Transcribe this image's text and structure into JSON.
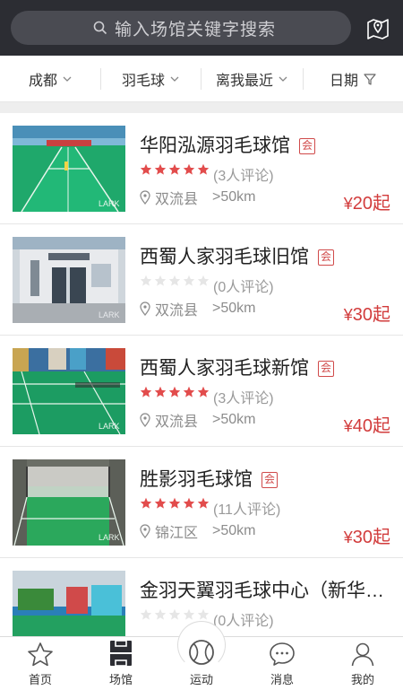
{
  "header": {
    "search_placeholder": "输入场馆关键字搜索",
    "icons": {
      "search": "search-icon",
      "map": "map-pin-icon"
    }
  },
  "filters": {
    "city": "成都",
    "sport": "羽毛球",
    "sort": "离我最近",
    "date": "日期"
  },
  "venues": [
    {
      "name": "华阳泓源羽毛球馆",
      "badge": "会",
      "stars": 5,
      "reviews": "(3人评论)",
      "district": "双流县",
      "distance": ">50km",
      "price": "20",
      "price_suffix": "起"
    },
    {
      "name": "西蜀人家羽毛球旧馆",
      "badge": "会",
      "stars": 0,
      "reviews": "(0人评论)",
      "district": "双流县",
      "distance": ">50km",
      "price": "30",
      "price_suffix": "起"
    },
    {
      "name": "西蜀人家羽毛球新馆",
      "badge": "会",
      "stars": 5,
      "reviews": "(3人评论)",
      "district": "双流县",
      "distance": ">50km",
      "price": "40",
      "price_suffix": "起"
    },
    {
      "name": "胜影羽毛球馆",
      "badge": "会",
      "stars": 5,
      "reviews": "(11人评论)",
      "district": "锦江区",
      "distance": ">50km",
      "price": "30",
      "price_suffix": "起"
    },
    {
      "name": "金羽天翼羽毛球中心（新华…",
      "badge": "",
      "stars": 0,
      "reviews": "(0人评论)",
      "district": "",
      "distance": "",
      "price": "",
      "price_suffix": ""
    }
  ],
  "currency": "¥",
  "tabs": [
    {
      "label": "首页",
      "icon": "star-icon"
    },
    {
      "label": "场馆",
      "icon": "court-icon"
    },
    {
      "label": "运动",
      "icon": "ball-icon"
    },
    {
      "label": "消息",
      "icon": "chat-icon"
    },
    {
      "label": "我的",
      "icon": "user-icon"
    }
  ],
  "colors": {
    "header_bg": "#2c2d33",
    "accent": "#d23c3c",
    "star": "#e24c4c"
  }
}
